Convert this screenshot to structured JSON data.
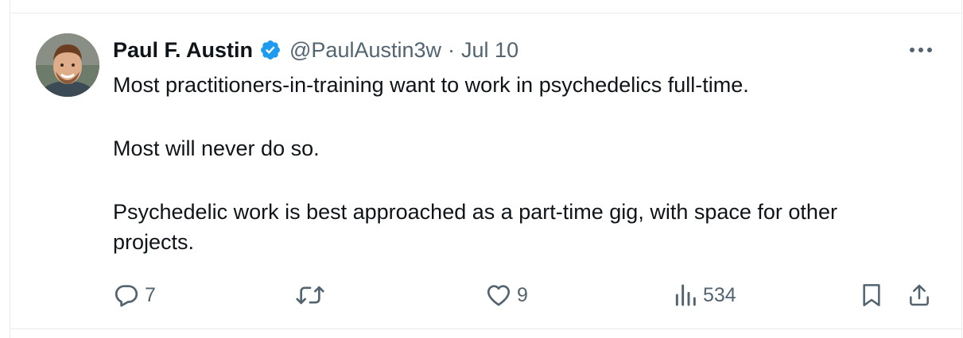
{
  "tweet": {
    "author": {
      "name": "Paul F. Austin",
      "handle": "@PaulAustin3w",
      "verified": true,
      "avatar_icon": "avatar-photo"
    },
    "separator": "·",
    "date": "Jul 10",
    "body": {
      "p1": "Most practitioners-in-training want to work in psychedelics full-time.",
      "p2": "Most will never do so.",
      "p3": "Psychedelic work is best approached as a part-time gig, with space for other projects."
    },
    "metrics": {
      "replies": "7",
      "retweets": "",
      "likes": "9",
      "views": "534"
    }
  },
  "colors": {
    "text": "#0f1419",
    "muted": "#536471",
    "verified": "#1d9bf0",
    "border": "#e8ebed"
  }
}
